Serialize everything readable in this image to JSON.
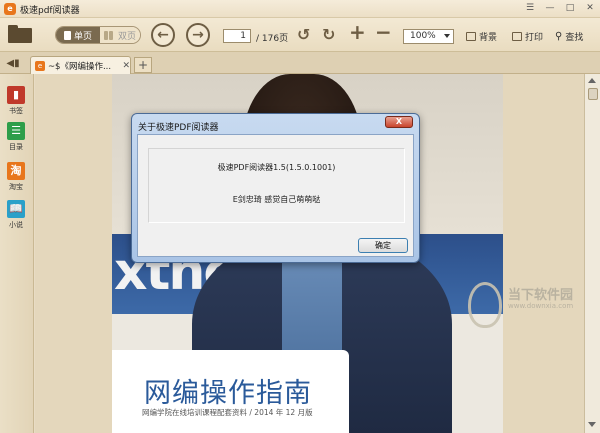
{
  "window": {
    "title": "极速pdf阅读器",
    "controls": [
      "menu-icon",
      "minimize-icon",
      "maximize-icon",
      "close-icon"
    ]
  },
  "toolbar": {
    "view_single": "单页",
    "view_double": "双页",
    "current_page": "1",
    "page_total": "/ 176页",
    "zoom": "100%",
    "background_label": "背景",
    "print_label": "打印",
    "search_label": "查找"
  },
  "tabs": {
    "doc_tab": "~$《网编操作...",
    "add_tab": "+"
  },
  "sidebar": {
    "items": [
      {
        "label": "书签",
        "icon": "bookmark-icon",
        "color": "#c0392b"
      },
      {
        "label": "目录",
        "icon": "toc-icon",
        "color": "#2e9e4a"
      },
      {
        "label": "淘宝",
        "icon": "taobao-icon",
        "color": "#e8761c"
      },
      {
        "label": "小说",
        "icon": "novel-icon",
        "color": "#2aa0c9"
      }
    ]
  },
  "document": {
    "banner_text": "xthe co",
    "cover_title": "网编操作指南",
    "cover_subtitle": "网编学院在线培训课程配套资料 / 2014 年 12 月版"
  },
  "dialog": {
    "title": "关于极速PDF阅读器",
    "close": "X",
    "version_text": "极速PDF阅读器1.5(1.5.0.1001)",
    "message_text": "E剑忠琦 感觉自己萌萌哒",
    "ok_label": "确定"
  },
  "watermark": {
    "name": "当下软件园",
    "url": "www.downxia.com"
  }
}
